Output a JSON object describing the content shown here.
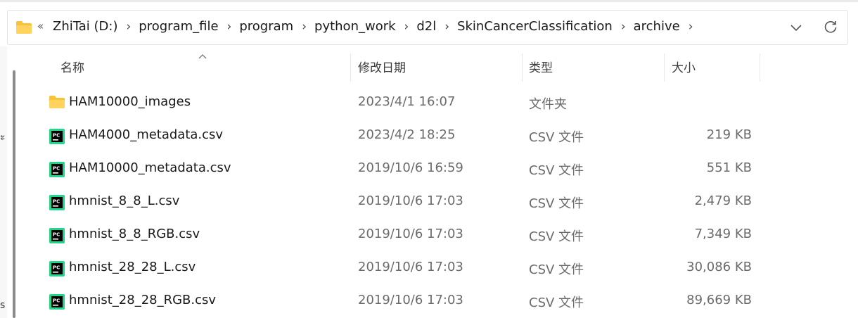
{
  "address_bar": {
    "overflow_glyph": "«",
    "crumbs": [
      "ZhiTai (D:)",
      "program_file",
      "program",
      "python_work",
      "d2l",
      "SkinCancerClassification",
      "archive"
    ]
  },
  "columns": {
    "name": "名称",
    "date": "修改日期",
    "type": "类型",
    "size": "大小"
  },
  "left_pane_fragments": [
    "ะ",
    "s"
  ],
  "files": [
    {
      "name": "HAM10000_images",
      "date": "2023/4/1 16:07",
      "type": "文件夹",
      "size": "",
      "icon": "folder-icon"
    },
    {
      "name": "HAM4000_metadata.csv",
      "date": "2023/4/2 18:25",
      "type": "CSV 文件",
      "size": "219 KB",
      "icon": "pycharm-csv-icon"
    },
    {
      "name": "HAM10000_metadata.csv",
      "date": "2019/10/6 16:59",
      "type": "CSV 文件",
      "size": "551 KB",
      "icon": "pycharm-csv-icon"
    },
    {
      "name": "hmnist_8_8_L.csv",
      "date": "2019/10/6 17:03",
      "type": "CSV 文件",
      "size": "2,479 KB",
      "icon": "pycharm-csv-icon"
    },
    {
      "name": "hmnist_8_8_RGB.csv",
      "date": "2019/10/6 17:03",
      "type": "CSV 文件",
      "size": "7,349 KB",
      "icon": "pycharm-csv-icon"
    },
    {
      "name": "hmnist_28_28_L.csv",
      "date": "2019/10/6 17:03",
      "type": "CSV 文件",
      "size": "30,086 KB",
      "icon": "pycharm-csv-icon"
    },
    {
      "name": "hmnist_28_28_RGB.csv",
      "date": "2019/10/6 17:03",
      "type": "CSV 文件",
      "size": "89,669 KB",
      "icon": "pycharm-csv-icon"
    }
  ],
  "colors": {
    "folder": "#f8c33a",
    "pycharm_green": "#21d789",
    "pycharm_black": "#000000"
  }
}
